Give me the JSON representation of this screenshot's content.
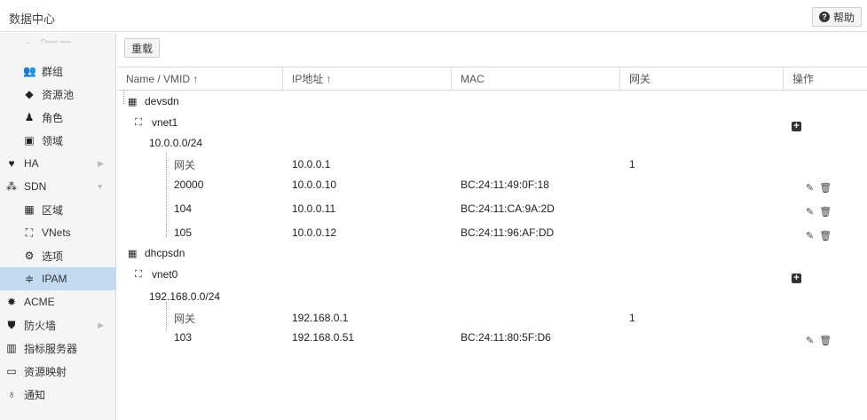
{
  "header": {
    "title": "数据中心",
    "help_label": "帮助"
  },
  "toolbar": {
    "reload_label": "重载"
  },
  "sidebar": {
    "cut_item": "、 ⌂— —",
    "items": [
      {
        "label": "群组",
        "icon": "users-icon"
      },
      {
        "label": "资源池",
        "icon": "tag-icon"
      },
      {
        "label": "角色",
        "icon": "male-icon"
      },
      {
        "label": "领域",
        "icon": "address-book-icon"
      },
      {
        "label": "HA",
        "icon": "heartbeat-icon"
      },
      {
        "label": "SDN",
        "icon": "sdn-icon"
      },
      {
        "label": "区域",
        "icon": "th-icon"
      },
      {
        "label": "VNets",
        "icon": "sitemap-icon"
      },
      {
        "label": "选项",
        "icon": "gear-icon"
      },
      {
        "label": "IPAM",
        "icon": "ipam-icon"
      },
      {
        "label": "ACME",
        "icon": "certificate-icon"
      },
      {
        "label": "防火墙",
        "icon": "shield-icon"
      },
      {
        "label": "指标服务器",
        "icon": "bar-chart-icon"
      },
      {
        "label": "资源映射",
        "icon": "folder-icon"
      },
      {
        "label": "通知",
        "icon": "bell-icon"
      }
    ]
  },
  "grid": {
    "columns": [
      "Name / VMID ↑",
      "IP地址 ↑",
      "MAC",
      "网关",
      "操作"
    ],
    "rows": [
      {
        "name": "devsdn",
        "ip": "",
        "mac": "",
        "gw": ""
      },
      {
        "name": "vnet1",
        "ip": "",
        "mac": "",
        "gw": ""
      },
      {
        "name": "10.0.0.0/24",
        "ip": "",
        "mac": "",
        "gw": ""
      },
      {
        "name": "网关",
        "ip": "10.0.0.1",
        "mac": "",
        "gw": "1"
      },
      {
        "name": "20000",
        "ip": "10.0.0.10",
        "mac": "BC:24:11:49:0F:18",
        "gw": ""
      },
      {
        "name": "104",
        "ip": "10.0.0.11",
        "mac": "BC:24:11:CA:9A:2D",
        "gw": ""
      },
      {
        "name": "105",
        "ip": "10.0.0.12",
        "mac": "BC:24:11:96:AF:DD",
        "gw": ""
      },
      {
        "name": "dhcpsdn",
        "ip": "",
        "mac": "",
        "gw": ""
      },
      {
        "name": "vnet0",
        "ip": "",
        "mac": "",
        "gw": ""
      },
      {
        "name": "192.168.0.0/24",
        "ip": "",
        "mac": "",
        "gw": ""
      },
      {
        "name": "网关",
        "ip": "192.168.0.1",
        "mac": "",
        "gw": "1"
      },
      {
        "name": "103",
        "ip": "192.168.0.51",
        "mac": "BC:24:11:80:5F:D6",
        "gw": ""
      }
    ]
  }
}
